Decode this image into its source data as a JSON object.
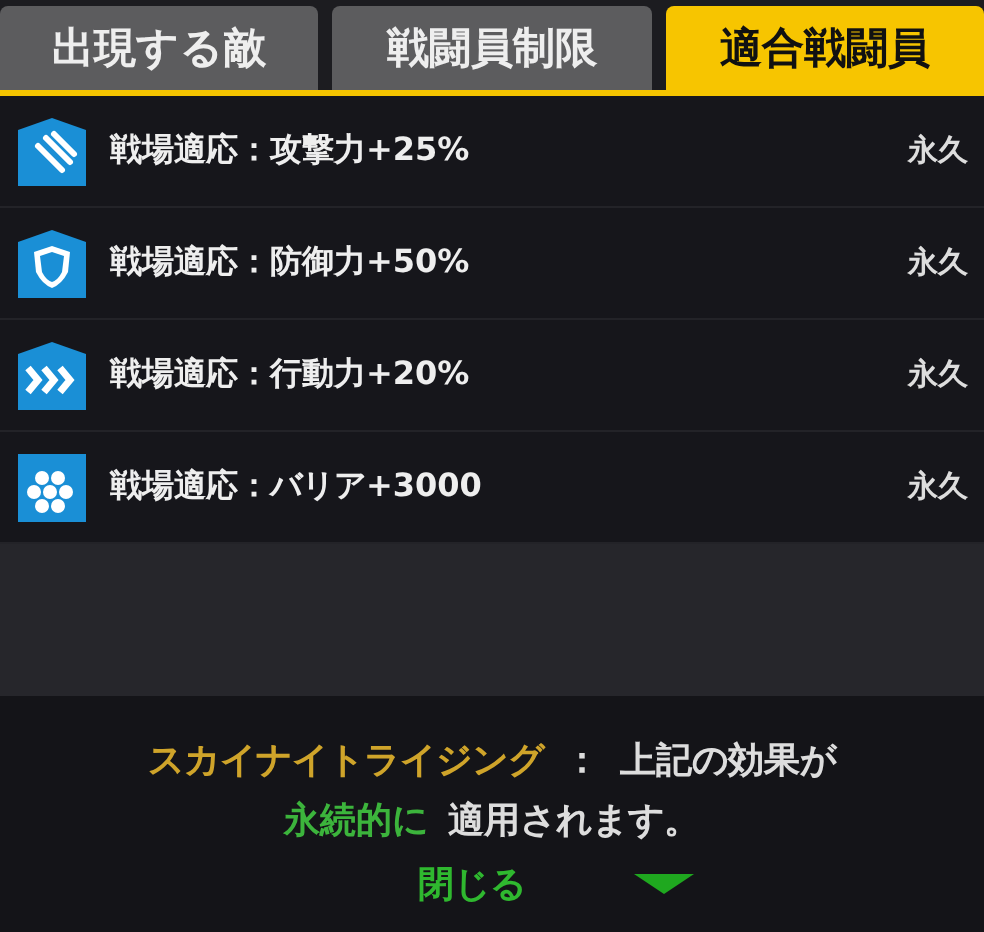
{
  "tabs": [
    {
      "label": "出現する敵",
      "selected": false
    },
    {
      "label": "戦闘員制限",
      "selected": false
    },
    {
      "label": "適合戦闘員",
      "selected": true
    }
  ],
  "effects": [
    {
      "kind": "attack",
      "label": "戦場適応：攻撃力+25%",
      "duration": "永久"
    },
    {
      "kind": "defense",
      "label": "戦場適応：防御力+50%",
      "duration": "永久"
    },
    {
      "kind": "action",
      "label": "戦場適応：行動力+20%",
      "duration": "永久"
    },
    {
      "kind": "barrier",
      "label": "戦場適応：バリア+3000",
      "duration": "永久"
    }
  ],
  "message": {
    "name": "スカイナイトライジング",
    "separator": "：",
    "text": "上記の効果が",
    "highlight": "永続的に",
    "text_2": "適用されます。"
  },
  "close_button": {
    "label": "閉じる"
  }
}
